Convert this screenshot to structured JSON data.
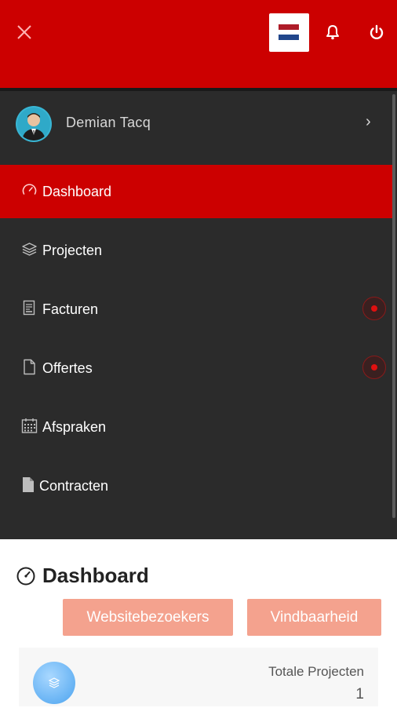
{
  "header": {
    "close_icon": "close-icon",
    "flag_colors": [
      "#ae1c28",
      "#ffffff",
      "#21468b"
    ],
    "bell_icon": "bell-icon",
    "power_icon": "power-icon"
  },
  "profile": {
    "name": "Demian Tacq",
    "avatar_icon": "avatar",
    "chevron": "›"
  },
  "menu": [
    {
      "label": "Dashboard",
      "icon": "dashboard-gauge-icon",
      "active": true,
      "badge": false
    },
    {
      "label": "Projecten",
      "icon": "layers-icon",
      "active": false,
      "badge": false
    },
    {
      "label": "Facturen",
      "icon": "invoice-icon",
      "active": false,
      "badge": true
    },
    {
      "label": "Offertes",
      "icon": "document-icon",
      "active": false,
      "badge": true
    },
    {
      "label": "Afspraken",
      "icon": "calendar-icon",
      "active": false,
      "badge": false
    },
    {
      "label": "Contracten",
      "icon": "contract-file-icon",
      "active": false,
      "badge": false
    }
  ],
  "main": {
    "title": "Dashboard",
    "buttons": [
      "Websitebezoekers",
      "Vindbaarheid"
    ],
    "card": {
      "label": "Totale Projecten",
      "value": "1"
    }
  },
  "colors": {
    "brand_red": "#cc0000",
    "drawer_bg": "#2b2b2b",
    "button_salmon": "#f4a28e"
  }
}
